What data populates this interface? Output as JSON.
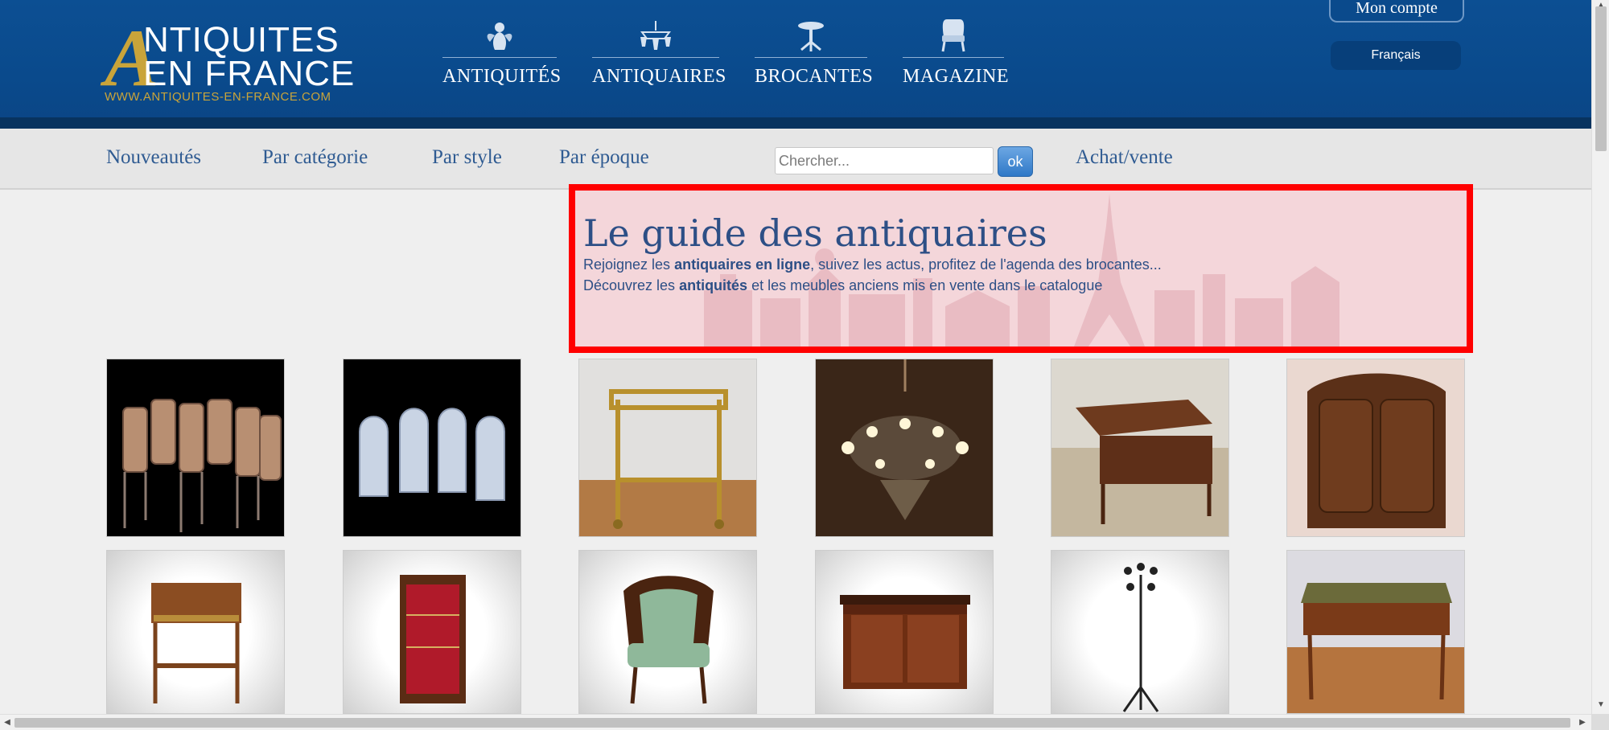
{
  "logo": {
    "letter": "A",
    "line1": "NTIQUITES",
    "line2": "EN FRANCE",
    "url": "WWW.ANTIQUITES-EN-FRANCE.COM"
  },
  "main_nav": {
    "items": [
      {
        "label": "ANTIQUITÉS",
        "icon": "cherub-icon"
      },
      {
        "label": "ANTIQUAIRES",
        "icon": "chandelier-icon"
      },
      {
        "label": "BROCANTES",
        "icon": "pedestal-table-icon"
      },
      {
        "label": "MAGAZINE",
        "icon": "armchair-icon"
      }
    ]
  },
  "account": {
    "label": "Mon compte"
  },
  "language": {
    "label": "Français"
  },
  "subnav": {
    "items": [
      {
        "label": "Nouveautés"
      },
      {
        "label": "Par catégorie"
      },
      {
        "label": "Par style"
      },
      {
        "label": "Par époque"
      },
      {
        "label": "Achat/vente"
      }
    ],
    "search": {
      "placeholder": "Chercher...",
      "value": "",
      "button_label": "ok"
    }
  },
  "banner": {
    "title": "Le guide des antiquaires",
    "line1": {
      "before": "Rejoignez les ",
      "bold": "antiquaires en ligne",
      "after": ", suivez les actus, profitez de l'agenda des brocantes..."
    },
    "line2": {
      "before": "Découvrez les ",
      "bold": "antiquités",
      "after": " et les meubles anciens mis en vente dans le catalogue"
    },
    "accent_color": "#ff0000"
  },
  "products": {
    "row1": [
      {
        "name": "dining-chairs-set-image"
      },
      {
        "name": "wicker-armchairs-image"
      },
      {
        "name": "gilt-serving-trolley-image"
      },
      {
        "name": "crystal-chandelier-image"
      },
      {
        "name": "writing-desk-image"
      },
      {
        "name": "carved-armoire-image"
      }
    ],
    "row2": [
      {
        "name": "side-table-image"
      },
      {
        "name": "display-cabinet-image"
      },
      {
        "name": "bergere-chair-image"
      },
      {
        "name": "empire-sideboard-image"
      },
      {
        "name": "coat-stand-image"
      },
      {
        "name": "bureau-plat-image"
      }
    ]
  },
  "colors": {
    "header_blue": "#0a4a8c",
    "gold": "#c9a43a",
    "link_blue": "#2f5b92"
  }
}
